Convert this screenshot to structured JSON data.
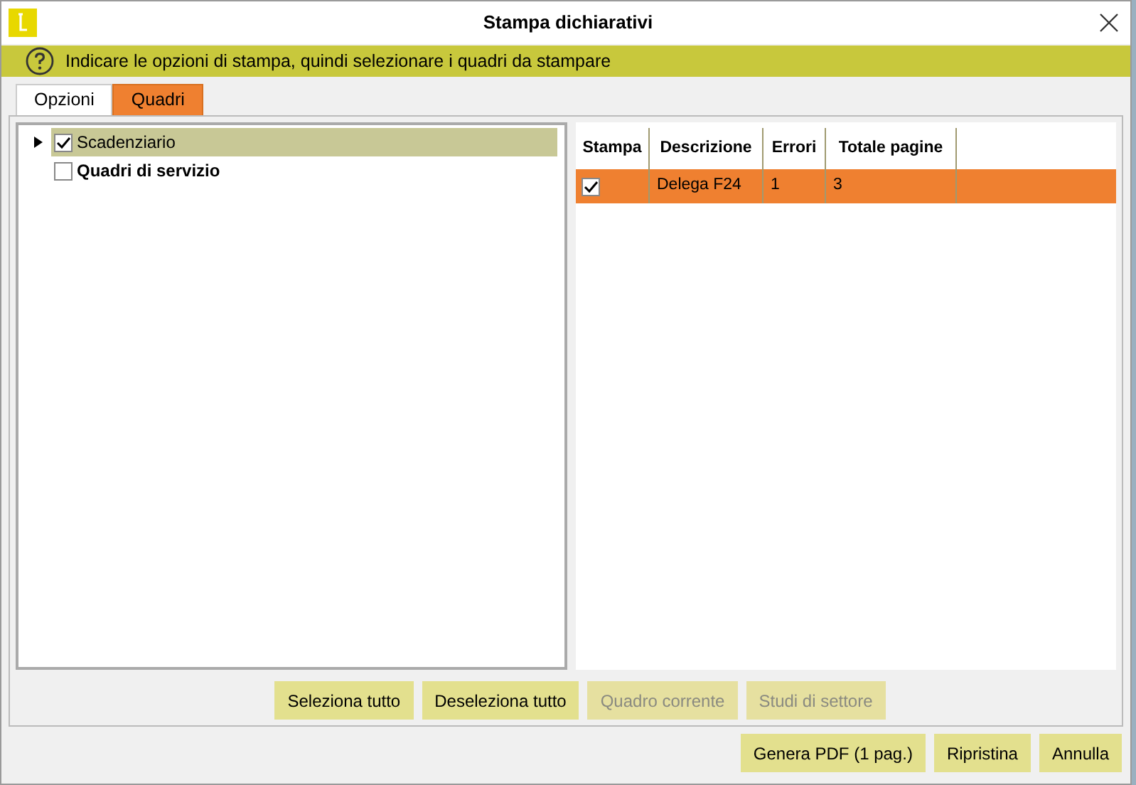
{
  "window": {
    "title": "Stampa dichiarativi"
  },
  "info_bar": {
    "text": "Indicare le opzioni di stampa, quindi selezionare i quadri da stampare"
  },
  "tabs": [
    {
      "label": "Opzioni",
      "selected": false
    },
    {
      "label": "Quadri",
      "selected": true
    }
  ],
  "tree": {
    "items": [
      {
        "label": "Scadenziario",
        "checked": true,
        "selected": true,
        "bold": false,
        "expanded": false
      },
      {
        "label": "Quadri di servizio",
        "checked": false,
        "selected": false,
        "bold": true
      }
    ]
  },
  "table": {
    "check_column": "Stampa",
    "columns": [
      "Descrizione",
      "Errori",
      "Totale pagine"
    ],
    "rows": [
      {
        "checked": true,
        "selected": true,
        "cells": [
          "Delega F24",
          "1",
          "3"
        ]
      }
    ]
  },
  "panel_buttons": [
    {
      "label": "Seleziona tutto",
      "disabled": false
    },
    {
      "label": "Deseleziona tutto",
      "disabled": false
    },
    {
      "label": "Quadro corrente",
      "disabled": true
    },
    {
      "label": "Studi di settore",
      "disabled": true
    }
  ],
  "footer_buttons": [
    {
      "label": "Genera PDF (1 pag.)",
      "disabled": false
    },
    {
      "label": "Ripristina",
      "disabled": false
    },
    {
      "label": "Annulla",
      "disabled": false
    }
  ]
}
